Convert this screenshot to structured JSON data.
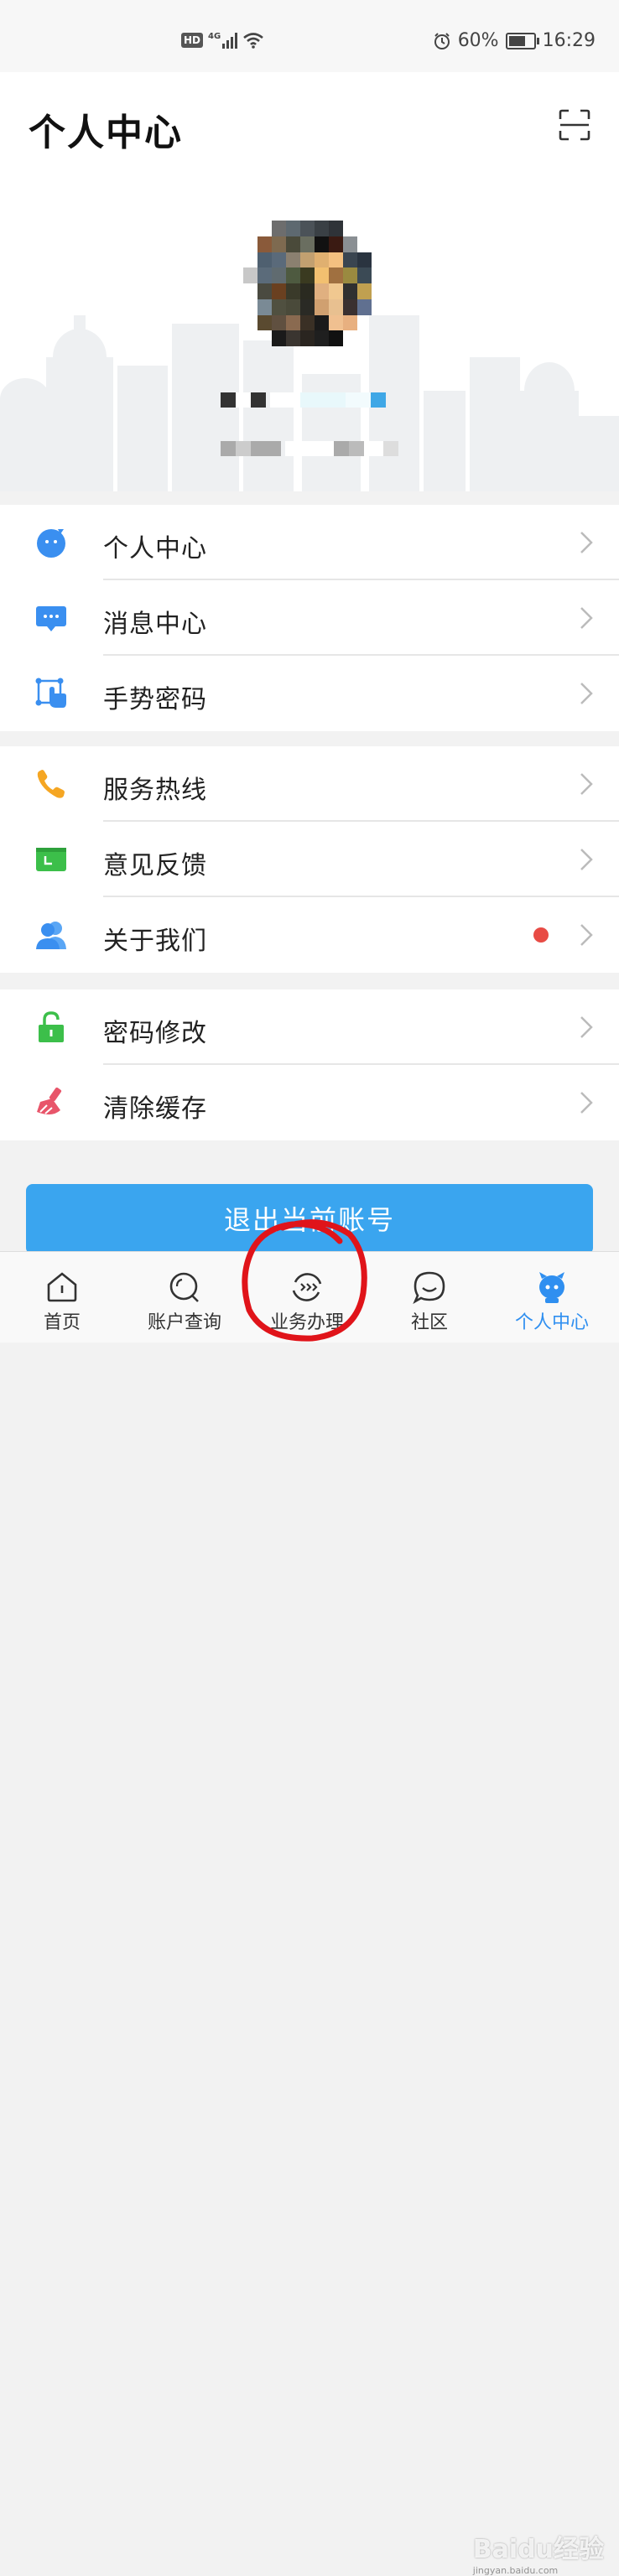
{
  "status_bar": {
    "left_icons": [
      "hd-icon",
      "4g-signal-icon",
      "wifi-icon"
    ],
    "hd_label": "HD",
    "network_label": "4G",
    "battery_percent": "60%",
    "time": "16:29",
    "battery_level": 0.6
  },
  "header": {
    "title": "个人中心",
    "scan_icon": "scan-icon"
  },
  "menu_groups": [
    {
      "items": [
        {
          "label": "个人中心",
          "icon": "profile-bubble-icon",
          "icon_color": "#3a8ff0"
        },
        {
          "label": "消息中心",
          "icon": "message-icon",
          "icon_color": "#3a8ff0"
        },
        {
          "label": "手势密码",
          "icon": "gesture-password-icon",
          "icon_color": "#3a8ff0"
        }
      ]
    },
    {
      "items": [
        {
          "label": "服务热线",
          "icon": "phone-icon",
          "icon_color": "#f5a623"
        },
        {
          "label": "意见反馈",
          "icon": "feedback-icon",
          "icon_color": "#3cbf4a"
        },
        {
          "label": "关于我们",
          "icon": "users-icon",
          "icon_color": "#3a8ff0",
          "badge": true
        }
      ]
    },
    {
      "items": [
        {
          "label": "密码修改",
          "icon": "lock-icon",
          "icon_color": "#3cbf4a"
        },
        {
          "label": "清除缓存",
          "icon": "broom-icon",
          "icon_color": "#e8556a"
        }
      ]
    }
  ],
  "logout_label": "退出当前账号",
  "tabs": [
    {
      "label": "首页",
      "icon": "home-icon"
    },
    {
      "label": "账户查询",
      "icon": "search-icon"
    },
    {
      "label": "业务办理",
      "icon": "service-icon"
    },
    {
      "label": "社区",
      "icon": "chat-bubble-icon"
    },
    {
      "label": "个人中心",
      "icon": "mascot-icon",
      "active": true
    }
  ],
  "watermark": {
    "text": "Baidu经验",
    "subtext": "jingyan.baidu.com"
  },
  "colors": {
    "accent": "#3aa5ef",
    "active_tab": "#2f8ff0",
    "badge": "#e84b45",
    "annotation": "#e0141a"
  }
}
